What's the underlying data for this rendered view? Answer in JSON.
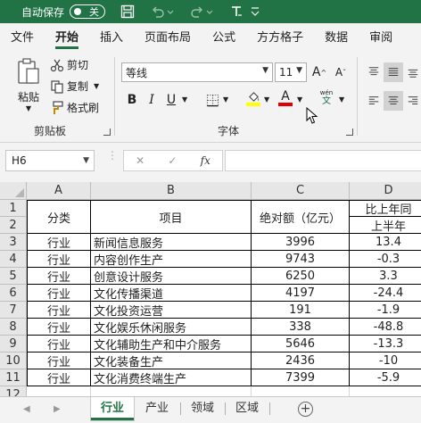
{
  "titlebar": {
    "autosave_label": "自动保存",
    "autosave_state": "关"
  },
  "ribbon_tabs": [
    "文件",
    "开始",
    "插入",
    "页面布局",
    "公式",
    "方方格子",
    "数据",
    "审阅"
  ],
  "clipboard": {
    "paste_label": "粘贴",
    "cut_label": "剪切",
    "copy_label": "复制",
    "format_painter_label": "格式刷",
    "group_label": "剪贴板"
  },
  "font": {
    "font_name": "等线",
    "font_size": "11",
    "bold": "B",
    "italic": "I",
    "underline": "U",
    "grow": "A",
    "shrink": "A",
    "font_color_glyph": "A",
    "wen_top": "wén",
    "wen_bottom": "文",
    "group_label": "字体",
    "highlight_color": "#ffff00",
    "font_color": "#e00000"
  },
  "formula_bar": {
    "name_box": "H6",
    "fx_label": "fx"
  },
  "columns": [
    "A",
    "B",
    "C",
    "D"
  ],
  "rows": [
    "1",
    "2",
    "3",
    "4",
    "5",
    "6",
    "7",
    "8",
    "9",
    "10",
    "11",
    "12"
  ],
  "table": {
    "header_a": "分类",
    "header_b": "项目",
    "header_c": "绝对额（亿元）",
    "header_d_top": "比上年同",
    "header_d_bottom": "上半年",
    "data": [
      {
        "a": "行业",
        "b": "新闻信息服务",
        "c": "3996",
        "d": "13.4"
      },
      {
        "a": "行业",
        "b": "内容创作生产",
        "c": "9743",
        "d": "-0.3"
      },
      {
        "a": "行业",
        "b": "创意设计服务",
        "c": "6250",
        "d": "3.3"
      },
      {
        "a": "行业",
        "b": "文化传播渠道",
        "c": "4197",
        "d": "-24.4"
      },
      {
        "a": "行业",
        "b": "文化投资运营",
        "c": "191",
        "d": "-1.9"
      },
      {
        "a": "行业",
        "b": "文化娱乐休闲服务",
        "c": "338",
        "d": "-48.8"
      },
      {
        "a": "行业",
        "b": "文化辅助生产和中介服务",
        "c": "5646",
        "d": "-13.3"
      },
      {
        "a": "行业",
        "b": "文化装备生产",
        "c": "2436",
        "d": "-10"
      },
      {
        "a": "行业",
        "b": "文化消费终端生产",
        "c": "7399",
        "d": "-5.9"
      }
    ]
  },
  "sheets": [
    "行业",
    "产业",
    "领域",
    "区域"
  ],
  "active_sheet": "行业",
  "accent_color": "#217346"
}
